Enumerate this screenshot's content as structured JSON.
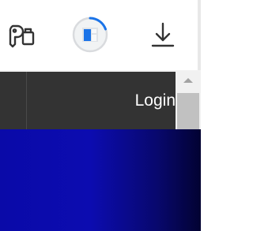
{
  "browser_toolbar": {
    "icons": [
      "password-key-icon",
      "extension-loading-icon",
      "download-icon"
    ]
  },
  "navbar": {
    "login_label": "Login"
  },
  "colors": {
    "toolbar_bg": "#ffffff",
    "navbar_bg": "#333333",
    "hero_blue": "#0c0cb0",
    "loading_accent": "#1a73e8"
  }
}
